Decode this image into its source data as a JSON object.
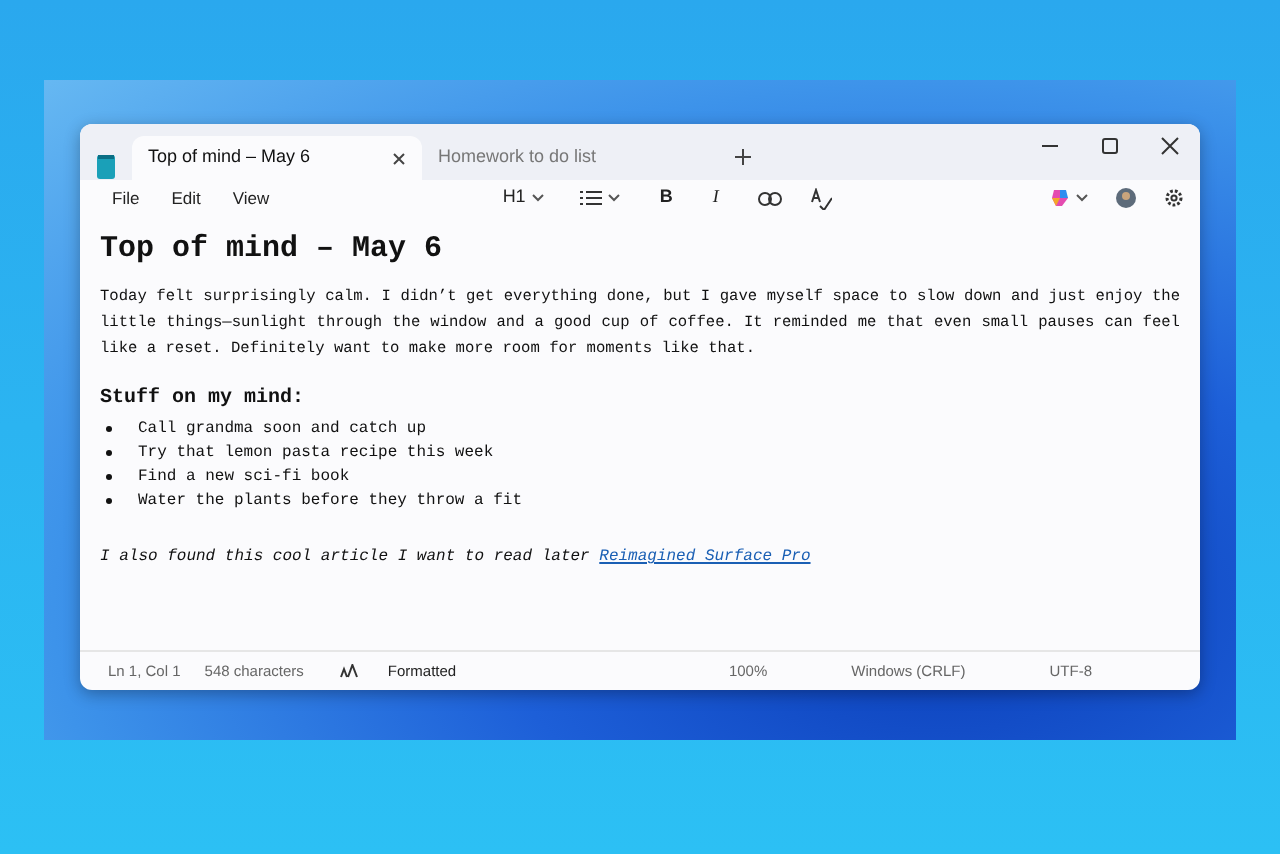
{
  "window": {
    "tabs": [
      {
        "label": "Top of mind – May 6",
        "selected": true
      },
      {
        "label": "Homework to do list",
        "selected": false
      }
    ]
  },
  "menu": [
    "File",
    "Edit",
    "View"
  ],
  "toolbar": {
    "heading": "H1",
    "bold": "B",
    "italic": "I"
  },
  "document": {
    "title": "Top of mind – May 6",
    "paragraph": "Today felt surprisingly calm. I didn’t get everything done, but I gave myself space to slow down and just enjoy the little things—sunlight through the window and a good cup of coffee. It reminded me that even small pauses can feel like a reset. Definitely want to make more room for moments like that.",
    "list_heading": "Stuff on my mind:",
    "list": [
      "Call grandma soon and catch up",
      "Try that lemon pasta recipe this week",
      "Find a new sci-fi book",
      "Water the plants before they throw a fit"
    ],
    "closing": {
      "text": "I also found this cool article I want to read later",
      "link": "Reimagined Surface Pro"
    }
  },
  "status_bar": {
    "position": "Ln 1, Col 1",
    "characters": "548 characters",
    "format": "Formatted",
    "zoom": "100%",
    "line_ending": "Windows (CRLF)",
    "encoding": "UTF-8"
  }
}
